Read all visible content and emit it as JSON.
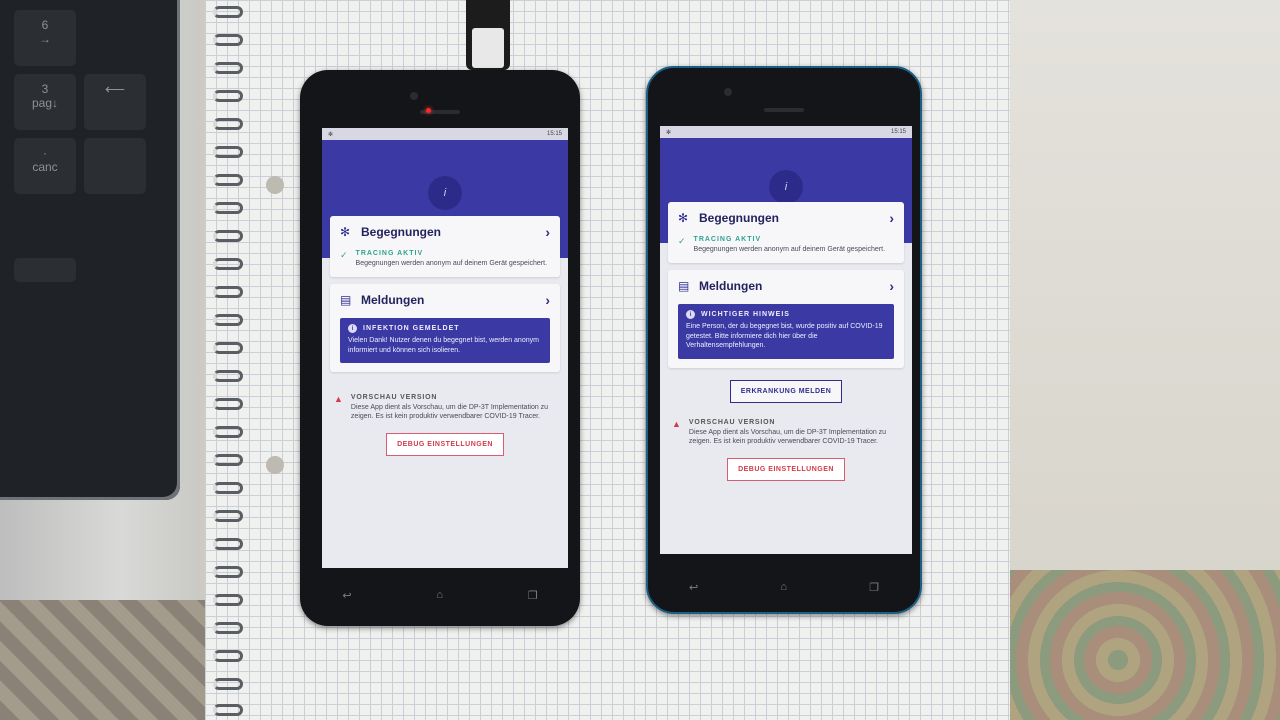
{
  "laptop": {
    "keys": [
      {
        "main": "6",
        "sub": "→"
      },
      {
        "main": "3",
        "sub": "pag↓"
      },
      {
        "main": "·",
        "sub": "canc"
      }
    ]
  },
  "phone1": {
    "time": "15:15",
    "card1": {
      "title": "Begegnungen",
      "status": "TRACING AKTIV",
      "text": "Begegnungen werden anonym auf deinem Gerät gespeichert."
    },
    "card2": {
      "title": "Meldungen",
      "alert_title": "INFEKTION GEMELDET",
      "alert_text": "Vielen Dank! Nutzer denen du begegnet bist, werden anonym informiert und können sich isolieren."
    },
    "preview_title": "VORSCHAU VERSION",
    "preview_text": "Diese App dient als Vorschau, um die DP-3T Implementation zu zeigen. Es ist kein produktiv verwendbarer COVID-19 Tracer.",
    "debug_button": "DEBUG EINSTELLUNGEN"
  },
  "phone2": {
    "time": "15:15",
    "card1": {
      "title": "Begegnungen",
      "status": "TRACING AKTIV",
      "text": "Begegnungen werden anonym auf deinem Gerät gespeichert."
    },
    "card2": {
      "title": "Meldungen",
      "alert_title": "WICHTIGER HINWEIS",
      "alert_text": "Eine Person, der du begegnet bist, wurde positiv auf COVID-19 getestet. Bitte informiere dich hier über die Verhaltensempfehlungen."
    },
    "report_button": "ERKRANKUNG MELDEN",
    "preview_title": "VORSCHAU VERSION",
    "preview_text": "Diese App dient als Vorschau, um die DP-3T Implementation zu zeigen. Es ist kein produktiv verwendbarer COVID-19 Tracer.",
    "debug_button": "DEBUG EINSTELLUNGEN"
  },
  "colors": {
    "brand": "#3b3aa4",
    "tracing": "#2fa38f",
    "warning": "#d33a4a"
  },
  "icons": {
    "info": "info-icon",
    "encounters": "bluetooth-network-icon",
    "messages": "message-icon",
    "check": "check-icon",
    "warning": "warning-triangle-icon",
    "back": "back-icon",
    "home": "home-icon",
    "recent": "recent-apps-icon"
  }
}
